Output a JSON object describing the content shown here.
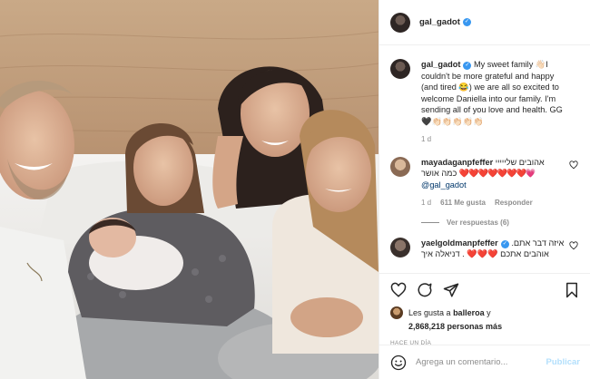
{
  "post": {
    "username": "gal_gadot",
    "photo_alt_icon": "family-photo"
  },
  "caption": {
    "username": "gal_gadot",
    "text": "My sweet family 👋🏻I couldn't be more grateful and happy (and tired 😂) we are all so excited to welcome Daniella into our family. I'm sending all of you love and health. GG 🖤👏🏻👏🏻👏🏻👏🏻👏🏻",
    "time": "1 d"
  },
  "comments": [
    {
      "username": "mayadaganpfeffer",
      "text_line1": "אהובים שלייייי",
      "text_line2": "כמה אושר",
      "hearts": "❤️❤️❤️❤️❤️❤️❤️💗",
      "mention": "@gal_gadot",
      "time": "1 d",
      "likes": "611 Me gusta",
      "reply": "Responder"
    },
    {
      "username": "yaelgoldmanpfeffer",
      "text": "איזה דבר אתם. אוהבים אתכם ❤️❤️❤️ . דניאלה איך"
    }
  ],
  "view_replies": "Ver respuestas (6)",
  "likes": {
    "prefix": "Les gusta a",
    "user": "balleroa",
    "suffix": "y",
    "count": "2,868,218 personas más"
  },
  "ago": "HACE UN DÍA",
  "add_comment": {
    "placeholder": "Agrega un comentario...",
    "publish": "Publicar"
  },
  "colors": {
    "verified": "#3897f0",
    "heart": "#ed4956",
    "publish_disabled": "#b2dffc",
    "meta": "#8e8e8e"
  }
}
